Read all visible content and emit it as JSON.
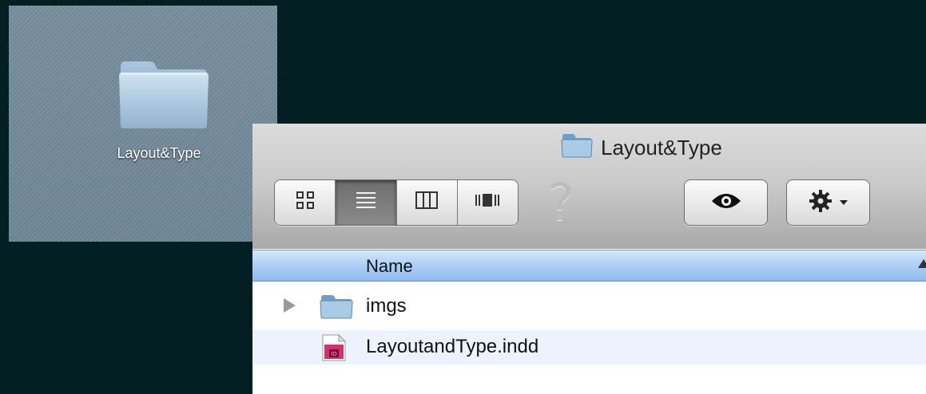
{
  "desktop": {
    "folder_label": "Layout&Type",
    "folder_icon": "folder-icon"
  },
  "window": {
    "title": "Layout&Type",
    "title_icon": "folder-icon"
  },
  "toolbar": {
    "view_buttons": [
      {
        "name": "icon-view",
        "icon": "icon-view-icon",
        "active": false
      },
      {
        "name": "list-view",
        "icon": "list-view-icon",
        "active": true
      },
      {
        "name": "column-view",
        "icon": "column-view-icon",
        "active": false
      },
      {
        "name": "cover-flow-view",
        "icon": "cover-flow-icon",
        "active": false
      }
    ],
    "help_glyph": "?",
    "quicklook_icon": "eye-icon",
    "action_icon": "gear-icon"
  },
  "list": {
    "column_header": "Name",
    "rows": [
      {
        "label": "imgs",
        "kind": "folder",
        "icon": "folder-icon",
        "expandable": true
      },
      {
        "label": "LayoutandType.indd",
        "kind": "indesign-document",
        "icon": "indesign-file-icon",
        "expandable": false
      }
    ]
  },
  "colors": {
    "background": "#031f23",
    "header_blue": "#a9cdf3",
    "alt_row": "#edf3fe",
    "indesign_pink": "#d1336e"
  }
}
